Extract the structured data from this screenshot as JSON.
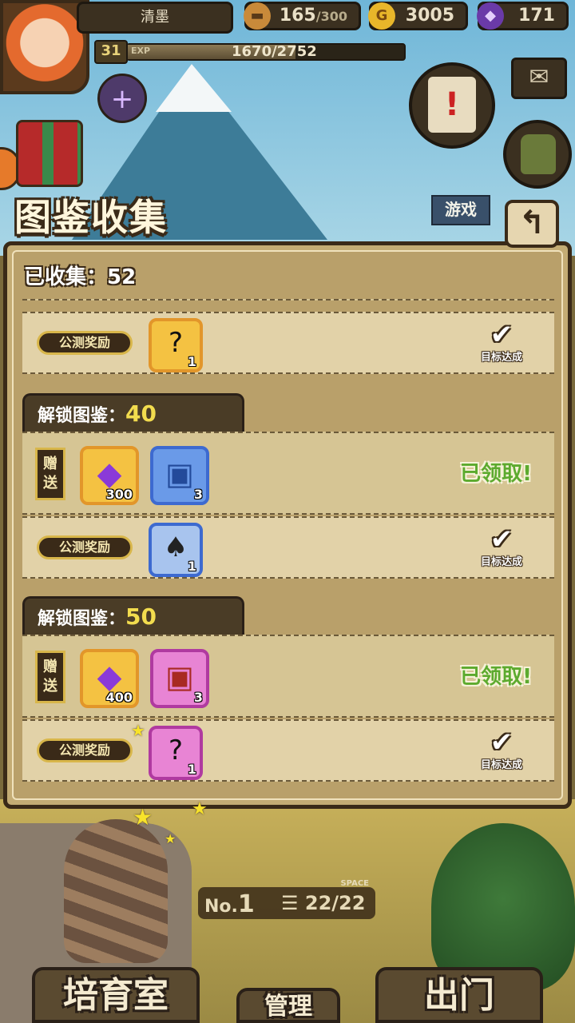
{
  "hud": {
    "player_name": "清墨",
    "stamina": "165",
    "stamina_max": "/300",
    "gold": "3005",
    "gems": "171",
    "level": "31",
    "exp_label": "EXP",
    "exp_text": "1670/2752",
    "exp_progress": 0.607,
    "game_tag": "游戏"
  },
  "panel": {
    "title": "图鉴收集",
    "collected_text": "已收集：52",
    "sections": [
      {
        "rows": [
          {
            "kind": "beta",
            "pill": "公测奖励",
            "items": [
              {
                "icon": "mystery-silhouette-icon",
                "qty": "1",
                "border": "#e2962a"
              }
            ],
            "status": "目标达成"
          }
        ]
      },
      {
        "header_label": "解锁图鉴：",
        "header_num": "40",
        "rows": [
          {
            "kind": "gift",
            "gift_tag": "赠送",
            "items": [
              {
                "icon": "purple-gem-icon",
                "qty": "300",
                "border": "#e2962a"
              },
              {
                "icon": "blue-chest-icon",
                "qty": "3",
                "border": "#3d6ad0"
              }
            ],
            "status": "已领取!"
          },
          {
            "kind": "beta",
            "pill": "公测奖励",
            "items": [
              {
                "icon": "top-hat-character-icon",
                "qty": "1",
                "border": "#3d6ad0"
              }
            ],
            "status": "目标达成"
          }
        ]
      },
      {
        "header_label": "解锁图鉴：",
        "header_num": "50",
        "rows": [
          {
            "kind": "gift",
            "gift_tag": "赠送",
            "items": [
              {
                "icon": "purple-gem-icon",
                "qty": "400",
                "border": "#e2962a"
              },
              {
                "icon": "red-chest-icon",
                "qty": "3",
                "border": "#b03aa0"
              }
            ],
            "status": "已领取!"
          },
          {
            "kind": "beta",
            "pill": "公测奖励",
            "items": [
              {
                "icon": "mystery-silhouette-icon",
                "qty": "1",
                "border": "#b03aa0"
              }
            ],
            "status": "目标达成"
          }
        ]
      }
    ]
  },
  "bottom": {
    "slot_no_prefix": "No.",
    "slot_no": "1",
    "space_label": "SPACE",
    "slot_count": "22/22",
    "btn_left": "培育室",
    "btn_center": "管理",
    "btn_right": "出门"
  },
  "colors": {
    "panel_bg": "#c4ac74",
    "claimed_green": "#5caa2e",
    "header_number_yellow": "#f2dc4e"
  }
}
